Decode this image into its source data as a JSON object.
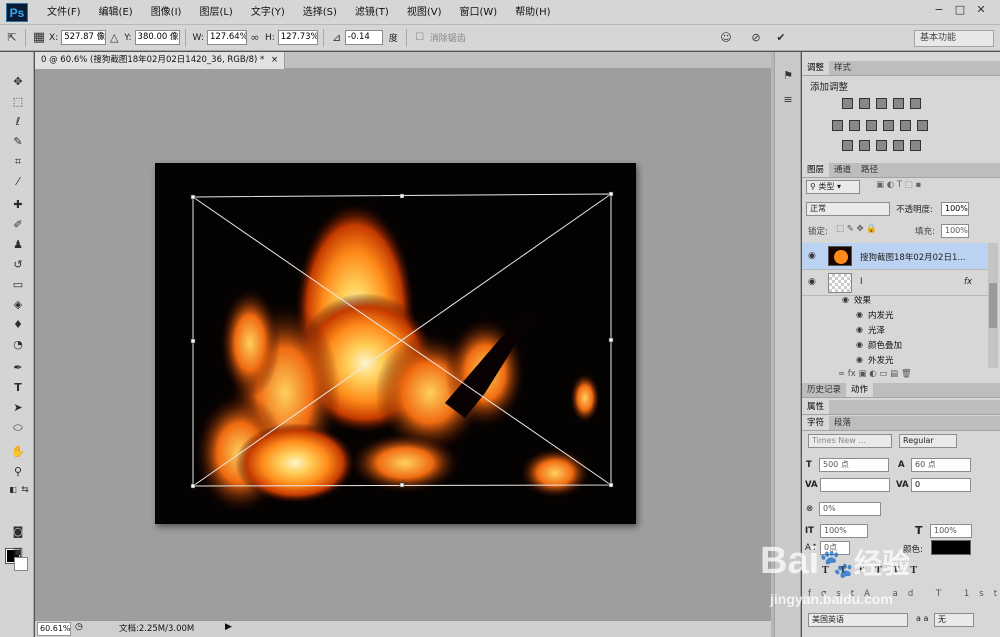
{
  "app": {
    "logo": "Ps",
    "menus": [
      "文件(F)",
      "编辑(E)",
      "图像(I)",
      "图层(L)",
      "文字(Y)",
      "选择(S)",
      "滤镜(T)",
      "视图(V)",
      "窗口(W)",
      "帮助(H)"
    ],
    "window_buttons": {
      "minimize": "−",
      "restore": "□",
      "close": "✕"
    }
  },
  "options_bar": {
    "x_label": "X:",
    "x_value": "527.87 像",
    "y_label": "Y:",
    "y_value": "380.00 像",
    "w_label": "W:",
    "w_value": "127.64%",
    "h_label": "H:",
    "h_value": "127.73%",
    "rotate_value": "-0.14",
    "rotate_unit": "度",
    "antialias_label": "消除锯齿",
    "workspace": "基本功能"
  },
  "document": {
    "tab_title": "0 @ 60.6% (搜狗截图18年02月02日1420_36, RGB/8) *",
    "tab_close": "×",
    "zoom": "60.61%",
    "doc_size": "文档:2.25M/3.00M"
  },
  "panels": {
    "adjust_tabs": [
      "调整",
      "样式"
    ],
    "adjust_title": "添加调整",
    "layer_tabs": [
      "图层",
      "通道",
      "路径"
    ],
    "filter_kind": "类型",
    "blend_mode": "正常",
    "opacity_label": "不透明度:",
    "opacity_value": "100%",
    "lock_label": "锁定:",
    "fill_label": "填充:",
    "fill_value": "100%",
    "layers": [
      {
        "name": "搜狗截图18年02月02日1..."
      },
      {
        "name": "I",
        "fx": "fx"
      }
    ],
    "effects_label": "效果",
    "effects": [
      "内发光",
      "光泽",
      "颜色叠加",
      "外发光"
    ],
    "history_tabs": [
      "历史记录",
      "动作"
    ],
    "properties_tab": "属性",
    "char_tabs": [
      "字符",
      "段落"
    ],
    "font_family": "Times New ...",
    "font_style": "Regular",
    "font_size": "500 点",
    "leading": "60 点",
    "tracking": "0",
    "scale_pct": "0%",
    "vscale": "100%",
    "hscale": "100%",
    "baseline": "0点",
    "color_label": "颜色:",
    "language": "美国英语",
    "aa_mode": "无",
    "aa_label": "a a"
  },
  "watermark": {
    "brand": "Bai",
    "brand2": "经验",
    "url": "jingyan.baidu.com"
  },
  "colors": {
    "accent_selected_layer": "#bcd2f2",
    "fire": "#ff8a1a"
  }
}
